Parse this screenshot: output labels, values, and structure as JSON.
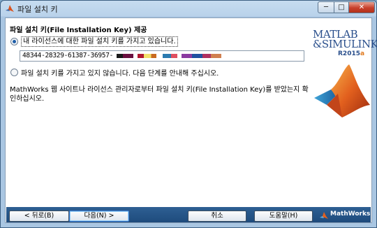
{
  "window": {
    "title": "파일 설치 키",
    "controls": {
      "minimize": "─",
      "maximize": "□",
      "close": "✕"
    }
  },
  "form": {
    "heading": "파일 설치 키(File Installation Key) 제공",
    "option_have_key": "내 라이선스에 대한 파일 설치 키를 가지고 있습니다.",
    "option_have_key_selected": true,
    "key_value": "48344-28329-61387-36957-",
    "option_no_key": "파일 설치 키를 가지고 있지 않습니다.  다음 단계를 안내해 주십시오.",
    "option_no_key_selected": false,
    "description": "MathWorks 웹 사이트나 라이선스 관리자로부터 파일 설치 키(File Installation Key)를 받았는지 확인하십시오."
  },
  "branding": {
    "matlab": "MATLAB",
    "amp_simulink": "&SIMULINK",
    "release": "R2015",
    "release_suffix": "a",
    "footer_logo": "MathWorks"
  },
  "buttons": {
    "back": "< 뒤로(B)",
    "next": "다음(N) >",
    "cancel": "취소",
    "help": "도움말(H)"
  },
  "colors": {
    "accent": "#1e4b7c",
    "logo_text": "#2a4f8c"
  }
}
